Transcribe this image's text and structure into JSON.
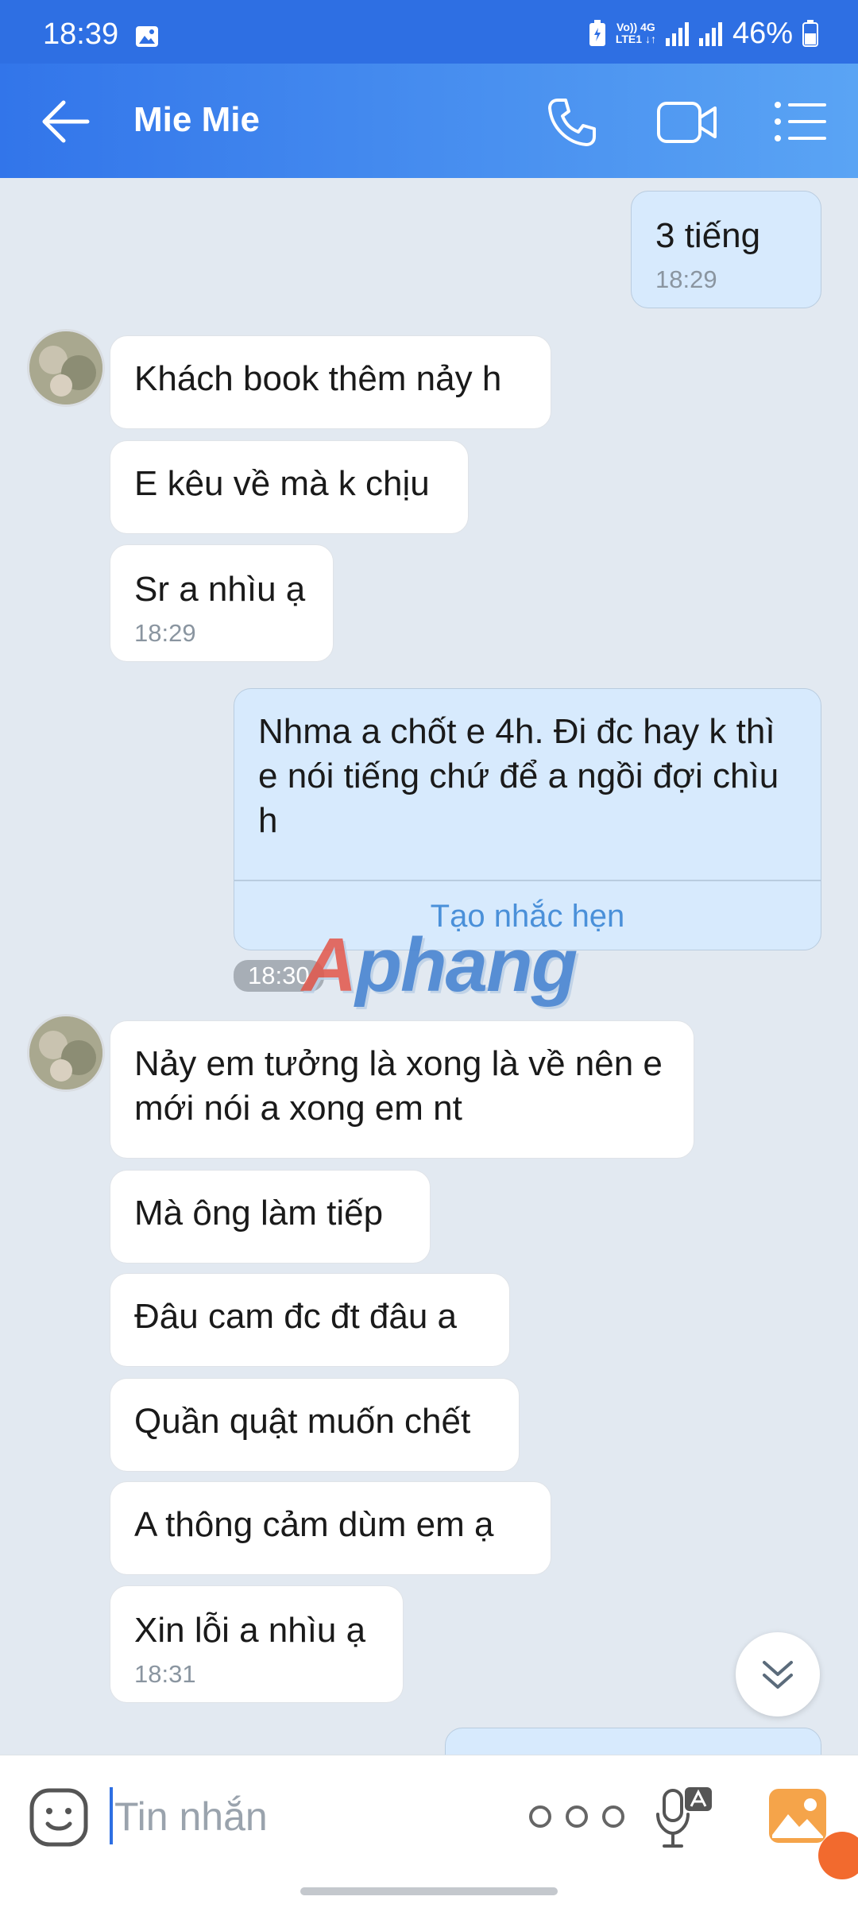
{
  "status_bar": {
    "time": "18:39",
    "net_top": "Vo)) 4G",
    "net_bottom": "LTE1 ↓↑",
    "battery": "46%"
  },
  "header": {
    "contact_name": "Mie Mie"
  },
  "messages": [
    {
      "dir": "out",
      "text": "3 tiếng",
      "time": "18:29"
    },
    {
      "dir": "in",
      "text": "Khách book thêm nảy h"
    },
    {
      "dir": "in",
      "text": "E kêu về mà k chịu"
    },
    {
      "dir": "in",
      "text": "Sr a nhìu ạ",
      "time": "18:29"
    },
    {
      "dir": "out",
      "text": "Nhma a chốt e 4h. Đi đc hay k thì e nói tiếng chứ để a ngồi đợi chìu h",
      "action": "Tạo nhắc hẹn",
      "time": "18:30"
    },
    {
      "dir": "in",
      "text": "Nảy em tưởng là xong là về nên e mới nói a xong em nt"
    },
    {
      "dir": "in",
      "text": "Mà ông làm tiếp"
    },
    {
      "dir": "in",
      "text": "Đâu cam đc đt đâu a"
    },
    {
      "dir": "in",
      "text": "Quần quật muốn chết"
    },
    {
      "dir": "in",
      "text": "A thông cảm dùm em ạ"
    },
    {
      "dir": "in",
      "text": "Xin lỗi a nhìu ạ",
      "time": "18:31"
    }
  ],
  "watermark": {
    "first": "A",
    "rest": "phang"
  },
  "composer": {
    "placeholder": "Tin nhắn"
  },
  "colors": {
    "header": "#3275ea",
    "outgoing_bubble": "#d7eafd",
    "incoming_bubble": "#ffffff",
    "background": "#e2e9f1"
  },
  "icons": [
    "back-arrow-icon",
    "phone-icon",
    "video-call-icon",
    "list-menu-icon",
    "emoji-icon",
    "more-dots-icon",
    "voice-to-text-icon",
    "gallery-icon",
    "scroll-down-icon"
  ]
}
